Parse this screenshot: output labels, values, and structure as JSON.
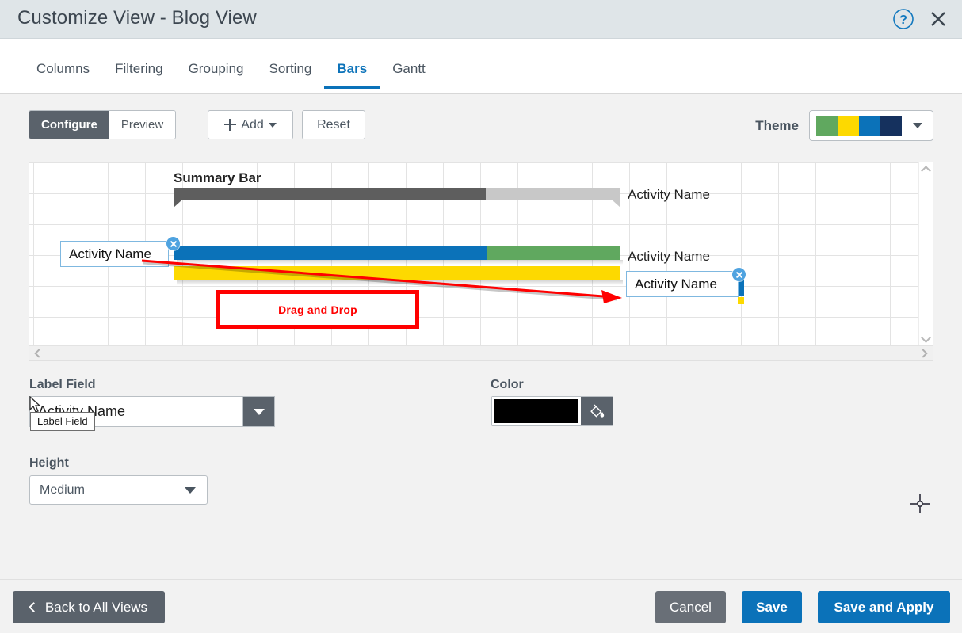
{
  "window": {
    "title": "Customize View - Blog View",
    "help_icon": "help-circle-icon",
    "close_icon": "close-icon"
  },
  "tabs": [
    {
      "label": "Columns",
      "active": false
    },
    {
      "label": "Filtering",
      "active": false
    },
    {
      "label": "Grouping",
      "active": false
    },
    {
      "label": "Sorting",
      "active": false
    },
    {
      "label": "Bars",
      "active": true
    },
    {
      "label": "Gantt",
      "active": false
    }
  ],
  "toolbar": {
    "configure_label": "Configure",
    "preview_label": "Preview",
    "add_label": "Add",
    "add_icon": "plus-icon",
    "add_caret_icon": "chevron-down-icon",
    "reset_label": "Reset",
    "theme_label": "Theme",
    "theme_caret_icon": "chevron-down-icon",
    "theme_swatches": [
      "#60a85f",
      "#fdd900",
      "#0b72b9",
      "#15315e"
    ]
  },
  "canvas": {
    "summary_bar_label": "Summary Bar",
    "row1_label": "Activity Name",
    "row2_label": "Activity Name",
    "chip_left_label": "Activity Name",
    "chip_right_label": "Activity Name",
    "chip_close_icon": "close-circle-icon",
    "annotation_label": "Drag and Drop",
    "annotation_color": "#ff0000",
    "bar_colors": {
      "summary_actual": "#5e5e5e",
      "summary_remaining": "#c8c8c8",
      "progress": "#0b72b9",
      "remaining": "#60a85f",
      "baseline": "#fdd900"
    },
    "scroll_left_icon": "chevron-left-icon",
    "scroll_right_icon": "chevron-right-icon",
    "scroll_up_icon": "chevron-up-icon",
    "scroll_down_icon": "chevron-down-icon"
  },
  "fields": {
    "label_field": {
      "label": "Label Field",
      "value": "Activity Name",
      "tooltip": "Label Field",
      "caret_icon": "chevron-down-icon"
    },
    "color": {
      "label": "Color",
      "value": "#000000",
      "bucket_icon": "paint-bucket-icon"
    },
    "height": {
      "label": "Height",
      "value": "Medium",
      "caret_icon": "chevron-down-icon"
    }
  },
  "footer": {
    "back_label": "Back to All Views",
    "back_icon": "chevron-left-icon",
    "cancel_label": "Cancel",
    "save_label": "Save",
    "save_apply_label": "Save and Apply"
  }
}
